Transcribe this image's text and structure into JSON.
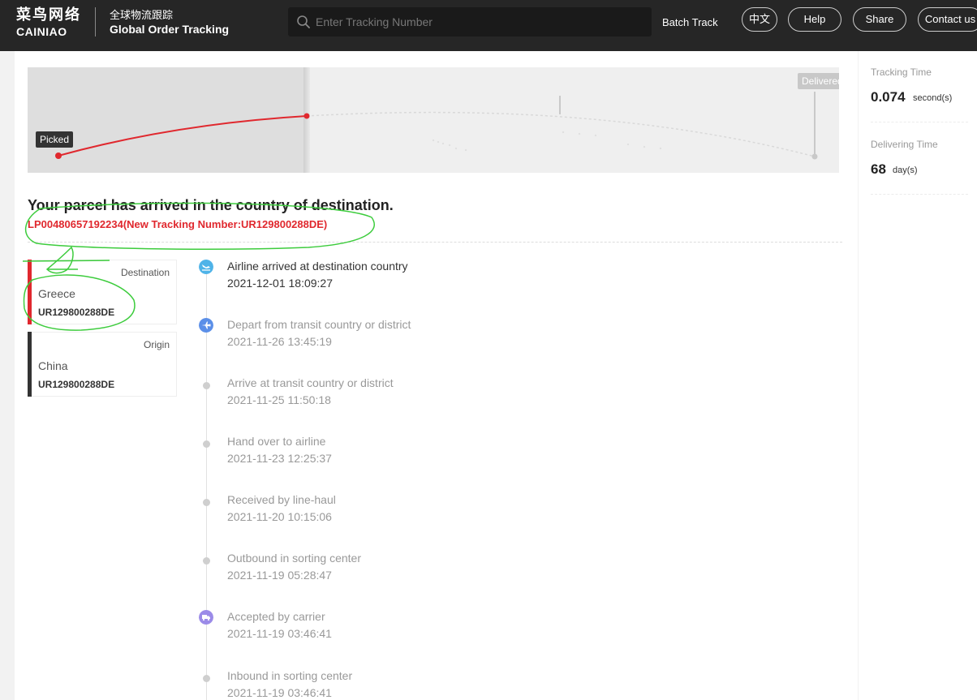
{
  "header": {
    "logo_cn": "菜鸟网络",
    "logo_en": "CAINIAO",
    "subtitle_cn": "全球物流跟踪",
    "subtitle_en": "Global Order Tracking",
    "search_placeholder": "Enter Tracking Number",
    "search_value": "",
    "search_icon": "search-icon",
    "batch_track": "Batch Track",
    "buttons": [
      "中文",
      "Help",
      "Share",
      "Contact us"
    ]
  },
  "map": {
    "picked_label": "Picked",
    "delivered_label": "Delivered",
    "accent_color": "#e0282e"
  },
  "parcel": {
    "status_title": "Your parcel has arrived in the country of destination.",
    "tracking_number": "LP00480657192234(New Tracking Number:UR129800288DE)"
  },
  "destination": {
    "label": "Destination",
    "country": "Greece",
    "code": "UR129800288DE",
    "bar_color": "#e0282e"
  },
  "origin": {
    "label": "Origin",
    "country": "China",
    "code": "UR129800288DE",
    "bar_color": "#333333"
  },
  "events": [
    {
      "title": "Airline arrived at destination country",
      "time": "2021-12-01 18:09:27",
      "icon": "plane-landing-icon"
    },
    {
      "title": "Depart from transit country or district",
      "time": "2021-11-26 13:45:19",
      "icon": "plane-icon"
    },
    {
      "title": "Arrive at transit country or district",
      "time": "2021-11-25 11:50:18",
      "icon": "dot"
    },
    {
      "title": "Hand over to airline",
      "time": "2021-11-23 12:25:37",
      "icon": "dot"
    },
    {
      "title": "Received by line-haul",
      "time": "2021-11-20 10:15:06",
      "icon": "dot"
    },
    {
      "title": "Outbound in sorting center",
      "time": "2021-11-19 05:28:47",
      "icon": "dot"
    },
    {
      "title": "Accepted by carrier",
      "time": "2021-11-19 03:46:41",
      "icon": "truck-icon"
    },
    {
      "title": "Inbound in sorting center",
      "time": "2021-11-19 03:46:41",
      "icon": "dot"
    }
  ],
  "stats": {
    "tracking_time_label": "Tracking Time",
    "tracking_time_value": "0.074",
    "tracking_time_unit": "second(s)",
    "delivering_time_label": "Delivering Time",
    "delivering_time_value": "68",
    "delivering_time_unit": "day(s)"
  }
}
